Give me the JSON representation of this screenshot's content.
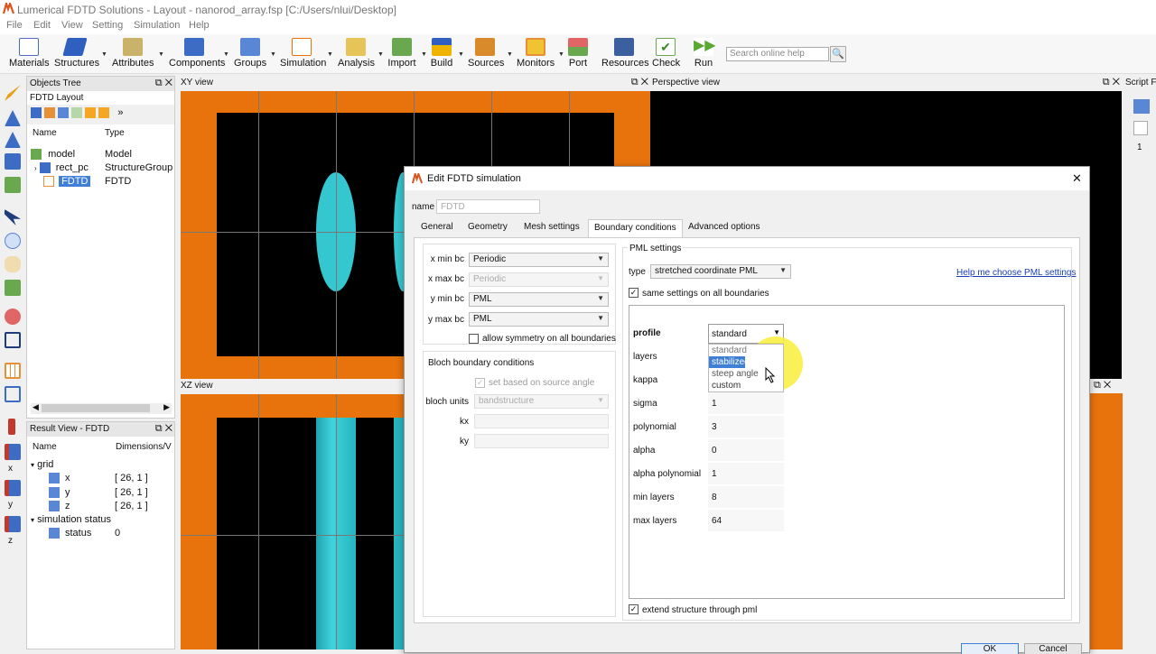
{
  "app": {
    "title": "Lumerical FDTD Solutions - Layout - nanorod_array.fsp [C:/Users/nlui/Desktop]"
  },
  "menu": [
    "File",
    "Edit",
    "View",
    "Setting",
    "Simulation",
    "Help"
  ],
  "toolbar": {
    "buttons": [
      "Materials",
      "Structures",
      "Attributes",
      "Components",
      "Groups",
      "Simulation",
      "Analysis",
      "Import",
      "Build",
      "Sources",
      "Monitors",
      "Port",
      "Resources",
      "Check",
      "Run"
    ],
    "search_placeholder": "Search online help"
  },
  "objects_tree": {
    "title": "Objects Tree",
    "subtitle": "FDTD Layout",
    "col_name": "Name",
    "col_type": "Type",
    "rows": [
      {
        "name": "model",
        "type": "Model"
      },
      {
        "name": "rect_pc",
        "type": "StructureGroup"
      },
      {
        "name": "FDTD",
        "type": "FDTD"
      }
    ]
  },
  "result_view": {
    "title": "Result View - FDTD",
    "col_name": "Name",
    "col_dims": "Dimensions/V",
    "groups": [
      {
        "name": "grid",
        "items": [
          {
            "name": "x",
            "value": "[ 26, 1 ]"
          },
          {
            "name": "y",
            "value": "[ 26, 1 ]"
          },
          {
            "name": "z",
            "value": "[ 26, 1 ]"
          }
        ]
      },
      {
        "name": "simulation status",
        "items": [
          {
            "name": "status",
            "value": "0"
          }
        ]
      }
    ]
  },
  "views": {
    "xy": "XY view",
    "xz": "XZ view",
    "perspective": "Perspective view",
    "script": "Script Fi",
    "script_line": "1"
  },
  "left_axis_labels": [
    "x",
    "y",
    "z"
  ],
  "dialog": {
    "title": "Edit FDTD simulation",
    "name_label": "name",
    "name_value": "FDTD",
    "tabs": [
      "General",
      "Geometry",
      "Mesh settings",
      "Boundary conditions",
      "Advanced options"
    ],
    "active_tab": "Boundary conditions",
    "bc": [
      {
        "label": "x min bc",
        "value": "Periodic",
        "disabled": false
      },
      {
        "label": "x max bc",
        "value": "Periodic",
        "disabled": true
      },
      {
        "label": "y min bc",
        "value": "PML",
        "disabled": false
      },
      {
        "label": "y max bc",
        "value": "PML",
        "disabled": false
      }
    ],
    "allow_symmetry_label": "allow symmetry on all boundaries",
    "bloch": {
      "title": "Bloch boundary conditions",
      "set_based_label": "set based on source angle",
      "units_label": "bloch units",
      "units_value": "bandstructure",
      "kx_label": "kx",
      "ky_label": "ky"
    },
    "pml": {
      "title": "PML settings",
      "type_label": "type",
      "type_value": "stretched coordinate PML",
      "help_link": "Help me choose PML settings",
      "same_settings_label": "same settings on all boundaries",
      "profile_label": "profile",
      "profile_value": "standard",
      "profile_options": [
        "standard",
        "stabilized",
        "steep angle",
        "custom"
      ],
      "highlighted_option": "stabilized",
      "params": [
        {
          "k": "layers",
          "v": ""
        },
        {
          "k": "kappa",
          "v": ""
        },
        {
          "k": "sigma",
          "v": "1"
        },
        {
          "k": "polynomial",
          "v": "3"
        },
        {
          "k": "alpha",
          "v": "0"
        },
        {
          "k": "alpha polynomial",
          "v": "1"
        },
        {
          "k": "min layers",
          "v": "8"
        },
        {
          "k": "max layers",
          "v": "64"
        }
      ],
      "extend_label": "extend structure through pml"
    },
    "ok_label": "OK",
    "cancel_label": "Cancel"
  },
  "colors": {
    "orange": "#e8720c",
    "cyan": "#35c7d0",
    "select_blue": "#3f7fd6",
    "link_blue": "#1a3fb5",
    "cursor_highlight": "#f8ee3a"
  }
}
